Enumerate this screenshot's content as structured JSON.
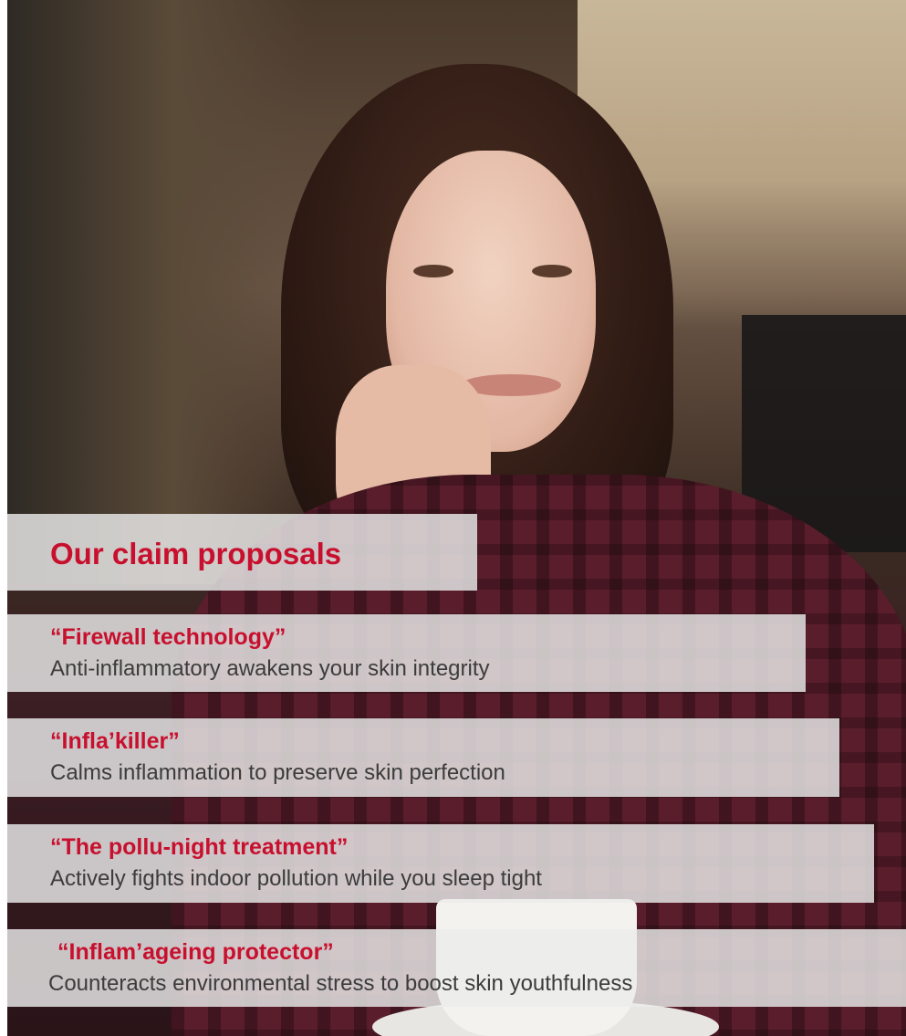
{
  "slide": {
    "heading": "Our claim proposals",
    "claims": [
      {
        "name": "“Firewall technology”",
        "description": "Anti-inflammatory awakens your skin integrity"
      },
      {
        "name": "“Infla’killer”",
        "description": "Calms inflammation to preserve skin perfection"
      },
      {
        "name": "“The pollu-night treatment”",
        "description": "Actively fights indoor pollution while you sleep tight"
      },
      {
        "name": "“Inflam’ageing protector”",
        "description": "Counteracts environmental stress to boost skin youthfulness"
      }
    ]
  },
  "colors": {
    "accent": "#c8102e",
    "text": "#3c3c3c",
    "panel": "#ebebeb"
  }
}
